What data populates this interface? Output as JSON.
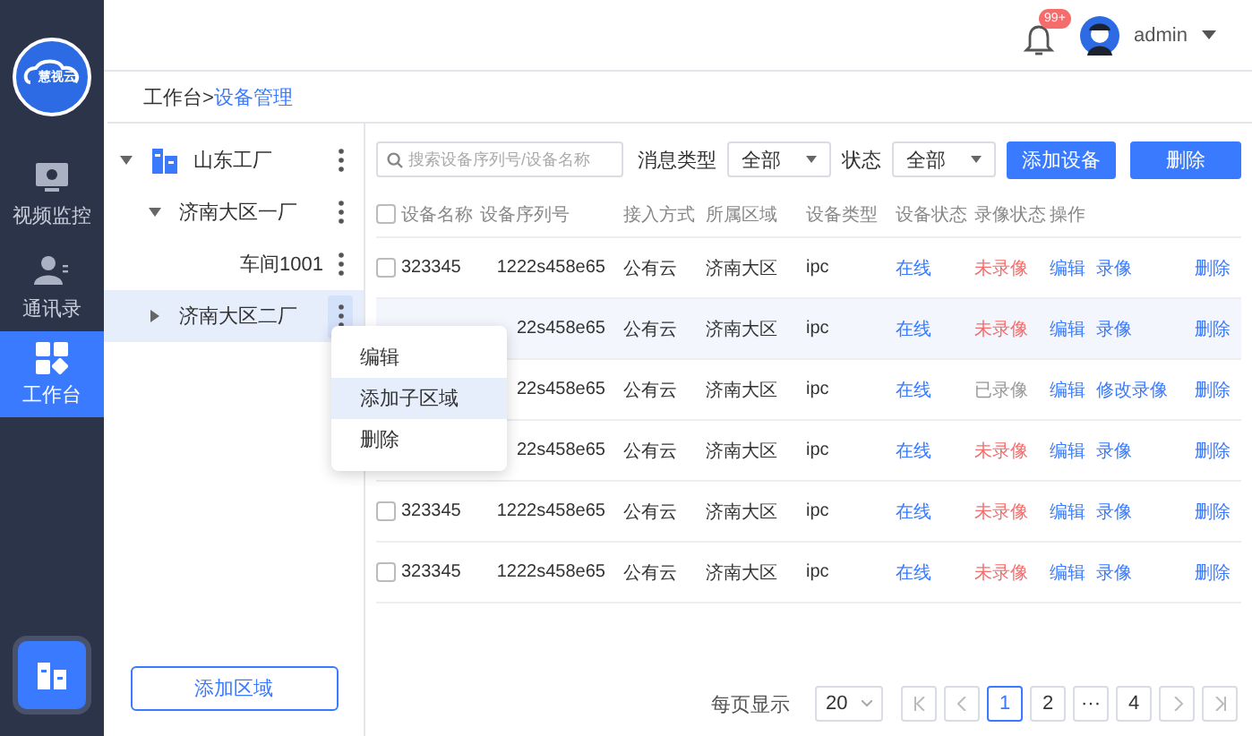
{
  "sidebar": {
    "logo_text": "慧视云",
    "items": [
      {
        "label": "视频监控",
        "selected": false
      },
      {
        "label": "通讯录",
        "selected": false
      },
      {
        "label": "工作台",
        "selected": true
      }
    ]
  },
  "header": {
    "notification_badge": "99+",
    "user": "admin"
  },
  "breadcrumb": [
    {
      "label": "工作台>",
      "current": false
    },
    {
      "label": "设备管理",
      "current": true
    }
  ],
  "tree": {
    "items": [
      {
        "label": "山东工厂",
        "expanded": true,
        "selected": false,
        "children": [
          {
            "label": "济南大区一厂",
            "expanded": true,
            "selected": false,
            "children": [
              {
                "label": "车间1001",
                "selected": false
              }
            ]
          },
          {
            "label": "济南大区二厂",
            "expanded": false,
            "selected": true
          }
        ]
      }
    ],
    "add_button": "添加区域"
  },
  "context_menu": [
    {
      "label": "编辑",
      "selected": false
    },
    {
      "label": "添加子区域",
      "selected": true
    },
    {
      "label": "删除",
      "selected": false
    }
  ],
  "toolbar": {
    "search": {
      "placeholder": "搜索设备序列号/设备名称"
    },
    "filters": [
      {
        "label": "消息类型",
        "value": "全部"
      },
      {
        "label": "状态",
        "value": "全部"
      }
    ],
    "buttons": [
      "添加设备",
      "删除"
    ]
  },
  "table": {
    "select_all_checked": false,
    "columns": [
      "设备名称",
      "设备序列号",
      "接入方式",
      "所属区域",
      "设备类型",
      "设备状态",
      "录像状态",
      "操作"
    ],
    "rows": [
      {
        "name": "323345",
        "checked": false,
        "serial": "1222s458e65",
        "access": "公有云",
        "region": "济南大区",
        "type": "ipc",
        "status": "在线",
        "record": "未录像",
        "recorded": false,
        "actions": [
          "编辑",
          "录像",
          "删除"
        ],
        "highlighted": false
      },
      {
        "serial": "22s458e65",
        "access": "公有云",
        "region": "济南大区",
        "type": "ipc",
        "status": "在线",
        "record": "未录像",
        "recorded": false,
        "actions": [
          "编辑",
          "录像",
          "删除"
        ],
        "highlighted": true
      },
      {
        "serial": "22s458e65",
        "access": "公有云",
        "region": "济南大区",
        "type": "ipc",
        "status": "在线",
        "record": "已录像",
        "recorded": true,
        "actions": [
          "编辑",
          "修改录像",
          "删除"
        ],
        "highlighted": false
      },
      {
        "serial": "22s458e65",
        "access": "公有云",
        "region": "济南大区",
        "type": "ipc",
        "status": "在线",
        "record": "未录像",
        "recorded": false,
        "actions": [
          "编辑",
          "录像",
          "删除"
        ],
        "highlighted": false
      },
      {
        "name": "323345",
        "checked": false,
        "serial": "1222s458e65",
        "access": "公有云",
        "region": "济南大区",
        "type": "ipc",
        "status": "在线",
        "record": "未录像",
        "recorded": false,
        "actions": [
          "编辑",
          "录像",
          "删除"
        ],
        "highlighted": false
      },
      {
        "name": "323345",
        "checked": false,
        "serial": "1222s458e65",
        "access": "公有云",
        "region": "济南大区",
        "type": "ipc",
        "status": "在线",
        "record": "未录像",
        "recorded": false,
        "actions": [
          "编辑",
          "录像",
          "删除"
        ],
        "highlighted": false
      }
    ]
  },
  "pagination": {
    "page_size_label": "每页显示",
    "page_size": "20",
    "pages": [
      {
        "label": "1",
        "selected": true
      },
      {
        "label": "2",
        "selected": false
      },
      {
        "label": "···",
        "selected": false
      },
      {
        "label": "4",
        "selected": false
      }
    ]
  }
}
